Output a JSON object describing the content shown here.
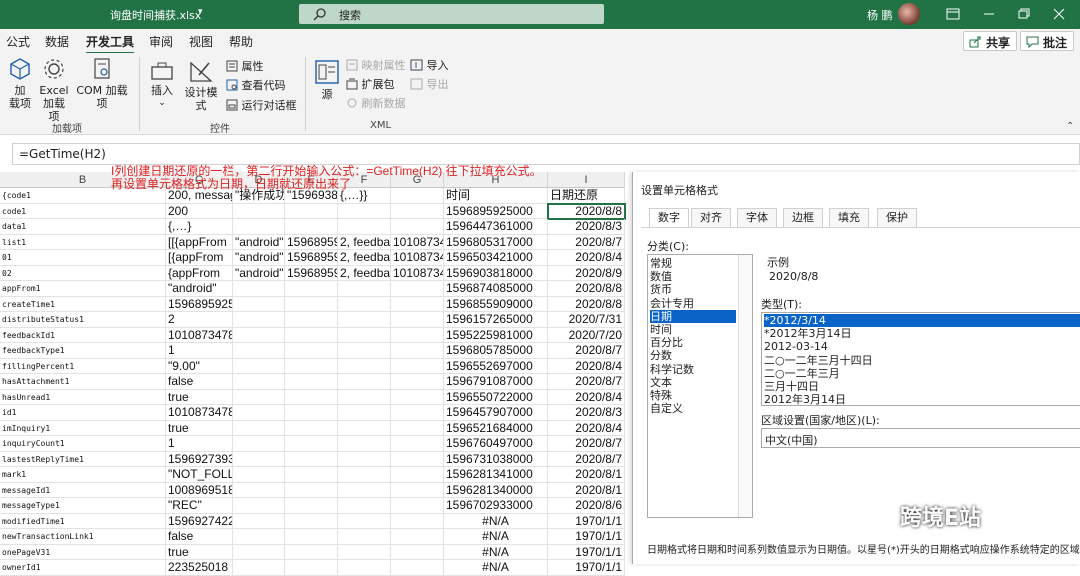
{
  "titlebar": {
    "filename": "询盘时间捕获.xlsx",
    "search": "搜索",
    "user": "杨 鹏"
  },
  "menu": {
    "items": [
      "公式",
      "数据",
      "开发工具",
      "审阅",
      "视图",
      "帮助"
    ],
    "share": "共享",
    "comments": "批注"
  },
  "ribbon": {
    "addins": {
      "add": "加\n载项",
      "excel_add": "Excel\n加载项",
      "com_add": "COM 加载项",
      "group": "加载项"
    },
    "controls": {
      "insert": "插入",
      "design": "设计模式",
      "props": "属性",
      "view_code": "查看代码",
      "run_dialog": "运行对话框",
      "group": "控件"
    },
    "xml": {
      "source": "源",
      "map_props": "映射属性",
      "ext_pack": "扩展包",
      "refresh": "刷新数据",
      "import": "导入",
      "export": "导出",
      "group": "XML"
    }
  },
  "formula_bar": {
    "value": "=GetTime(H2)"
  },
  "annotation": {
    "line1": "I列创建日期还原的一栏，第二行开始输入公式：=GetTime(H2)  往下拉填充公式。",
    "line2": "再设置单元格格式为日期，日期就还原出来了"
  },
  "grid": {
    "columns": [
      "B",
      "C",
      "D",
      "E",
      "F",
      "G",
      "H",
      "I"
    ],
    "rows": [
      [
        "{code1",
        "200, messag",
        "\"操作成功",
        "\"1596938",
        "{,…}}",
        "",
        "时间",
        "日期还原"
      ],
      [
        "code1",
        "200",
        "",
        "",
        "",
        "",
        "1596895925000",
        "2020/8/8"
      ],
      [
        "data1",
        "{,…}",
        "",
        "",
        "",
        "",
        "1596447361000",
        "2020/8/3"
      ],
      [
        "list1",
        "[[{appFrom",
        "\"android\"",
        "15968959",
        "2, feedba",
        "10108734",
        "1596805317000",
        "2020/8/7"
      ],
      [
        "01",
        "[{appFrom",
        "\"android\"",
        "15968959",
        "2, feedba",
        "10108734",
        "1596503421000",
        "2020/8/4"
      ],
      [
        "02",
        "{appFrom",
        "\"android\"",
        "15968959",
        "2, feedba",
        "10108734",
        "1596903818000",
        "2020/8/9"
      ],
      [
        "appFrom1",
        "\"android\"",
        "",
        "",
        "",
        "",
        "1596874085000",
        "2020/8/8"
      ],
      [
        "createTime1",
        "1596895925000",
        "",
        "",
        "",
        "",
        "1596855909000",
        "2020/8/8"
      ],
      [
        "distributeStatus1",
        "2",
        "",
        "",
        "",
        "",
        "1596157265000",
        "2020/7/31"
      ],
      [
        "feedbackId1",
        "101087347839",
        "",
        "",
        "",
        "",
        "1595225981000",
        "2020/7/20"
      ],
      [
        "feedbackType1",
        "1",
        "",
        "",
        "",
        "",
        "1596805785000",
        "2020/8/7"
      ],
      [
        "fillingPercent1",
        "\"9.00\"",
        "",
        "",
        "",
        "",
        "1596552697000",
        "2020/8/4"
      ],
      [
        "hasAttachment1",
        "false",
        "",
        "",
        "",
        "",
        "1596791087000",
        "2020/8/7"
      ],
      [
        "hasUnread1",
        "true",
        "",
        "",
        "",
        "",
        "1596550722000",
        "2020/8/4"
      ],
      [
        "id1",
        "101087347839",
        "",
        "",
        "",
        "",
        "1596457907000",
        "2020/8/3"
      ],
      [
        "imInquiry1",
        "true",
        "",
        "",
        "",
        "",
        "1596521684000",
        "2020/8/4"
      ],
      [
        "inquiryCount1",
        "1",
        "",
        "",
        "",
        "",
        "1596760497000",
        "2020/8/7"
      ],
      [
        "lastestReplyTime1",
        "1596927393000",
        "",
        "",
        "",
        "",
        "1596731038000",
        "2020/8/7"
      ],
      [
        "mark1",
        "\"NOT_FOLLOW\"",
        "",
        "",
        "",
        "",
        "1596281341000",
        "2020/8/1"
      ],
      [
        "messageId1",
        "100896951839",
        "",
        "",
        "",
        "",
        "1596281340000",
        "2020/8/1"
      ],
      [
        "messageType1",
        "\"REC\"",
        "",
        "",
        "",
        "",
        "1596702933000",
        "2020/8/6"
      ],
      [
        "modifiedTime1",
        "1596927422000",
        "",
        "",
        "",
        "",
        "#N/A",
        "1970/1/1"
      ],
      [
        "newTransactionLink1",
        "false",
        "",
        "",
        "",
        "",
        "#N/A",
        "1970/1/1"
      ],
      [
        "onePageV31",
        "true",
        "",
        "",
        "",
        "",
        "#N/A",
        "1970/1/1"
      ],
      [
        "ownerId1",
        "223525018",
        "",
        "",
        "",
        "",
        "#N/A",
        "1970/1/1"
      ]
    ]
  },
  "dialog": {
    "title": "设置单元格格式",
    "tabs": [
      "数字",
      "对齐",
      "字体",
      "边框",
      "填充",
      "保护"
    ],
    "category_label": "分类(C):",
    "categories": [
      "常规",
      "数值",
      "货币",
      "会计专用",
      "日期",
      "时间",
      "百分比",
      "分数",
      "科学记数",
      "文本",
      "特殊",
      "自定义"
    ],
    "selected_category": "日期",
    "sample_label": "示例",
    "sample_value": "2020/8/8",
    "type_label": "类型(T):",
    "types": [
      "*2012/3/14",
      "*2012年3月14日",
      "2012-03-14",
      "二○一二年三月十四日",
      "二○一二年三月",
      "三月十四日",
      "2012年3月14日"
    ],
    "locale_label": "区域设置(国家/地区)(L):",
    "locale_value": "中文(中国)",
    "description": "日期格式将日期和时间系列数值显示为日期值。以星号(*)开头的日期格式响应操作系统特定的区域日期和时间设置的更改。不带星号的格式不受操作系统设置的影响。"
  },
  "watermark": "跨境E站",
  "colors": {
    "excel_green": "#217346",
    "annotation_red": "#e02020",
    "selection_blue": "#0a64c8"
  }
}
